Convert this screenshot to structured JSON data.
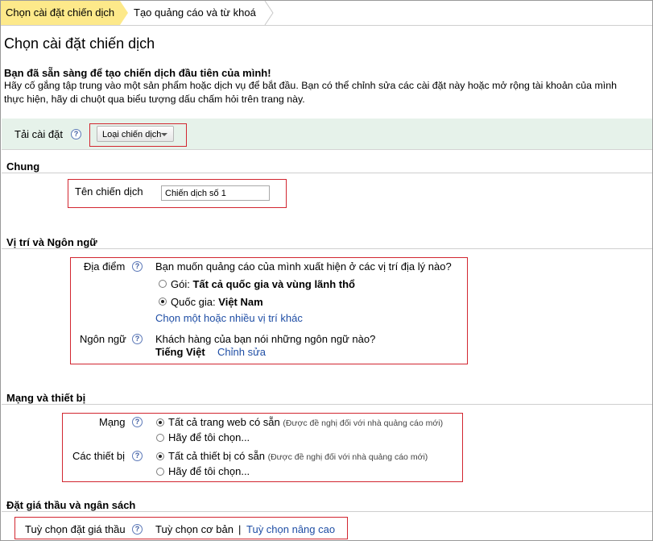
{
  "breadcrumb": {
    "step1": "Chọn cài đặt chiến dịch",
    "step2": "Tạo quảng cáo và từ khoá"
  },
  "page": {
    "title": "Chọn cài đặt chiến dịch",
    "intro_bold": "Bạn đã sẵn sàng để tạo chiến dịch đầu tiên của mình!",
    "intro_line1": "Hãy cố gắng tập trung vào một sản phẩm hoặc dịch vụ để bắt đầu. Bạn có thể chỉnh sửa các cài đặt này hoặc mở rộng tài khoản của mình",
    "intro_line2": "thực hiện, hãy di chuột qua biểu tượng dấu chấm hỏi trên trang này."
  },
  "load_settings": {
    "label": "Tải cài đặt",
    "dropdown": "Loại chiến dịch"
  },
  "general": {
    "heading": "Chung",
    "name_label": "Tên chiến dịch",
    "name_value": "Chiến dịch số 1"
  },
  "location_language": {
    "heading": "Vị trí và Ngôn ngữ",
    "location_label": "Địa điểm",
    "location_question": "Bạn muốn quảng cáo của mình xuất hiện ở các vị trí địa lý nào?",
    "opt1_prefix": "Gói:",
    "opt1_value": "Tất cả quốc gia và vùng lãnh thổ",
    "opt2_prefix": "Quốc gia:",
    "opt2_value": "Việt Nam",
    "location_link": "Chọn một hoặc nhiều vị trí khác",
    "language_label": "Ngôn ngữ",
    "language_question": "Khách hàng của bạn nói những ngôn ngữ nào?",
    "language_value": "Tiếng Việt",
    "language_edit": "Chỉnh sửa"
  },
  "networks_devices": {
    "heading": "Mạng và thiết bị",
    "network_label": "Mạng",
    "network_opt1": "Tất cả trang web có sẵn",
    "network_opt1_note": "(Được đề nghị đối với nhà quảng cáo mới)",
    "network_opt2": "Hãy để tôi chọn...",
    "devices_label": "Các thiết bị",
    "devices_opt1": "Tất cả thiết bị có sẵn",
    "devices_opt1_note": "(Được đề nghị đối với nhà quảng cáo mới)",
    "devices_opt2": "Hãy để tôi chọn..."
  },
  "bidding": {
    "heading": "Đặt giá thầu và ngân sách",
    "option_label": "Tuỳ chọn đặt giá thầu",
    "basic": "Tuỳ chọn cơ bản",
    "separator": "|",
    "advanced": "Tuỳ chọn nâng cao"
  },
  "icons": {
    "help": "?"
  },
  "colors": {
    "accent_red": "#d22630",
    "link_blue": "#1f4ea5",
    "active_step": "#fde98a",
    "load_bar": "#e6f2ea"
  }
}
